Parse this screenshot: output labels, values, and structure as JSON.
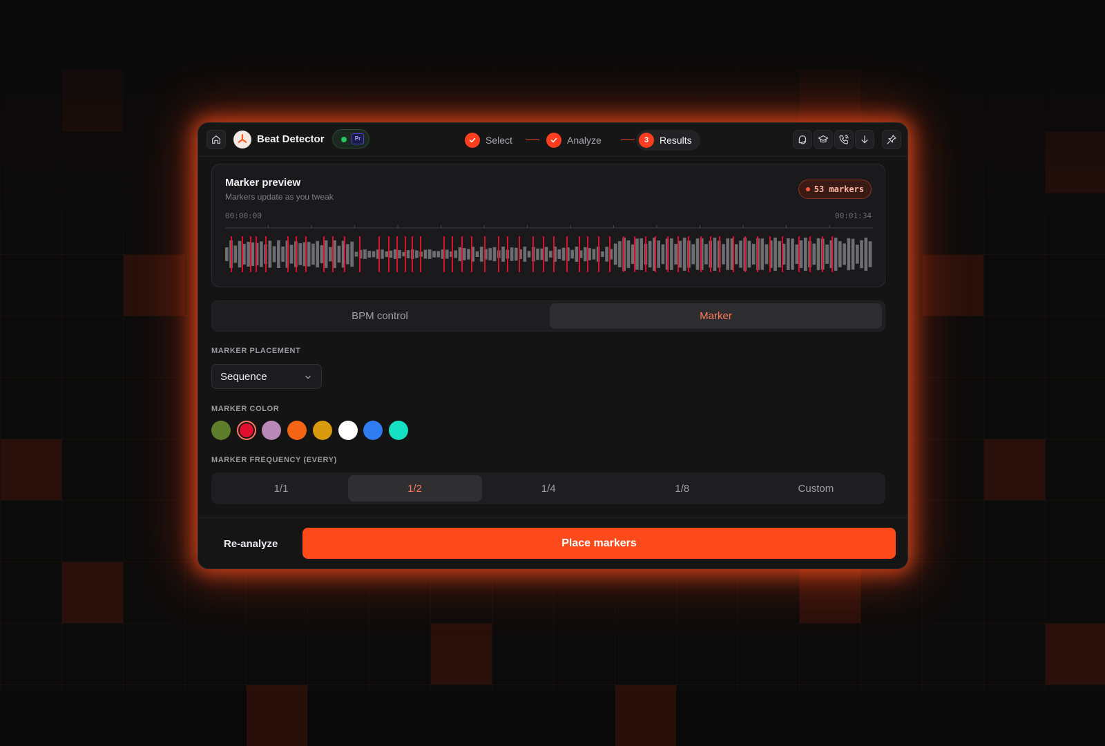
{
  "app": {
    "title": "Beat Detector",
    "host_badge": "Pr",
    "connected": true
  },
  "steps": [
    {
      "label": "Select",
      "state": "done"
    },
    {
      "label": "Analyze",
      "state": "done"
    },
    {
      "label": "Results",
      "state": "active",
      "number": "3"
    }
  ],
  "toolbar_icons": [
    "chat-icon",
    "graduation-cap-icon",
    "phone-icon",
    "download-icon",
    "pin-icon"
  ],
  "preview": {
    "title": "Marker preview",
    "subtitle": "Markers update as you tweak",
    "markers_count_label": "53 markers",
    "time_start": "00:00:00",
    "time_end": "00:01:34"
  },
  "tabs": [
    {
      "label": "BPM control",
      "active": false
    },
    {
      "label": "Marker",
      "active": true
    }
  ],
  "marker_placement": {
    "label": "MARKER PLACEMENT",
    "value": "Sequence"
  },
  "marker_color": {
    "label": "MARKER COLOR",
    "swatches": [
      "#5e7d2a",
      "#e0102e",
      "#b98ab9",
      "#f36414",
      "#d99a0e",
      "#ffffff",
      "#2f7cf0",
      "#16e0c4"
    ],
    "selected_index": 1
  },
  "marker_frequency": {
    "label": "MARKER FREQUENCY (EVERY)",
    "options": [
      "1/1",
      "1/2",
      "1/4",
      "1/8",
      "Custom"
    ],
    "selected_index": 1
  },
  "footer": {
    "secondary_label": "Re-analyze",
    "primary_label": "Place markers"
  },
  "colors": {
    "accent": "#ff4b1c",
    "marker_line": "#e0102e",
    "success": "#22c55e"
  }
}
